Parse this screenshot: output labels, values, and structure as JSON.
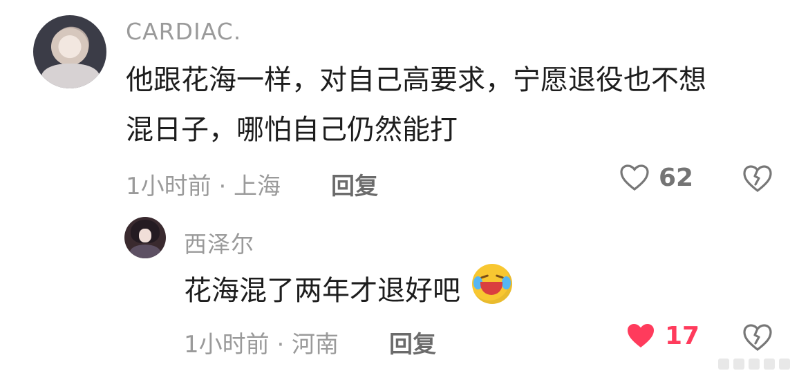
{
  "comments": {
    "main": {
      "username": "CARDIAC.",
      "text_line_1": "他跟花海一样，对自己高要求，宁愿退役也不想",
      "text_line_2": "混日子，哪怕自己仍然能打",
      "meta": "1小时前 · 上海",
      "reply_label": "回复",
      "likes": "62",
      "like_state": "not_liked",
      "like_icon": "heart-outline-icon",
      "dislike_icon": "broken-heart-icon",
      "colors": {
        "text": "#1d1d1d",
        "meta": "#9a9a9a",
        "icon": "#747474"
      }
    },
    "reply": {
      "username": "西泽尔",
      "text": "花海混了两年才退好吧",
      "emoji": "crying-laughing-face",
      "meta": "1小时前 · 河南",
      "reply_label": "回复",
      "likes": "17",
      "like_state": "liked",
      "like_icon": "heart-filled-icon",
      "dislike_icon": "broken-heart-icon",
      "colors": {
        "liked": "#ff3b5c",
        "text": "#1d1d1d",
        "meta": "#9a9a9a"
      }
    }
  }
}
